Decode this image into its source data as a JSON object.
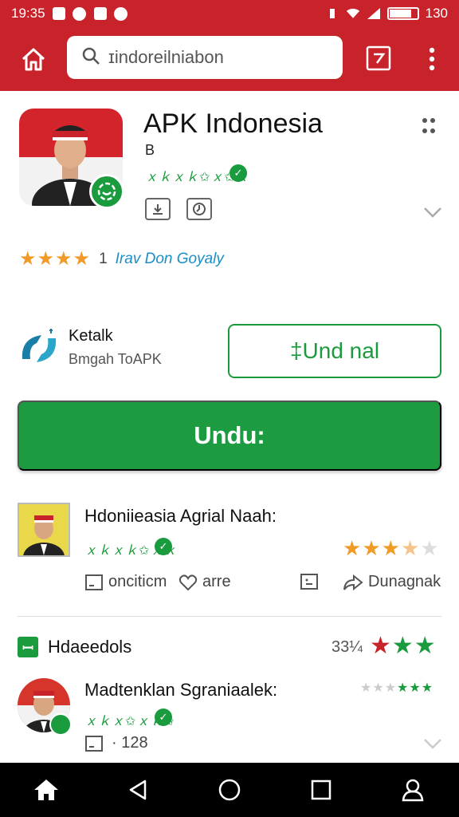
{
  "status_bar": {
    "time": "19:35",
    "battery": "130",
    "battery_level": 0.8
  },
  "search": {
    "value": "ɪindoreilniabon"
  },
  "app": {
    "title": "APK Indonesia",
    "sub_label": "B",
    "stars_text": "ｘｋｘｋ✩ｘ✩ｘ",
    "rating_stars": "★★★★",
    "rating_count": "1",
    "rating_link": "Irav Don Goyaly"
  },
  "developer": {
    "name": "Ketalk",
    "subtitle": "Bmgah ToAPK"
  },
  "buttons": {
    "outline_label": "‡Und nal",
    "primary_label": "Undu:"
  },
  "item1": {
    "title": "Hdoniieasia Agrial Naah:",
    "stars_text": "ｘｋｘｋ✩ｘｋ",
    "rating": 3.5,
    "actions": [
      "onciticm",
      "arre",
      "",
      "Dunagnak"
    ]
  },
  "section": {
    "title": "Hdaeedols",
    "count": "33¼"
  },
  "item2": {
    "title": "Madtenklan Sgraniaalek:",
    "stars_text": "ｘｋｘ✩ｘｋ✩",
    "meta": "· 128"
  },
  "colors": {
    "brand_red": "#c8232b",
    "accent_green": "#1a9b3d",
    "star_orange": "#f29a27",
    "link_blue": "#1a8fc4"
  },
  "icons": {
    "appbar": [
      "home-icon",
      "search-icon",
      "calendar-icon",
      "more-vert-icon"
    ],
    "navbar": [
      "home-icon",
      "back-icon",
      "circle-home-icon",
      "recents-icon",
      "account-icon"
    ]
  }
}
